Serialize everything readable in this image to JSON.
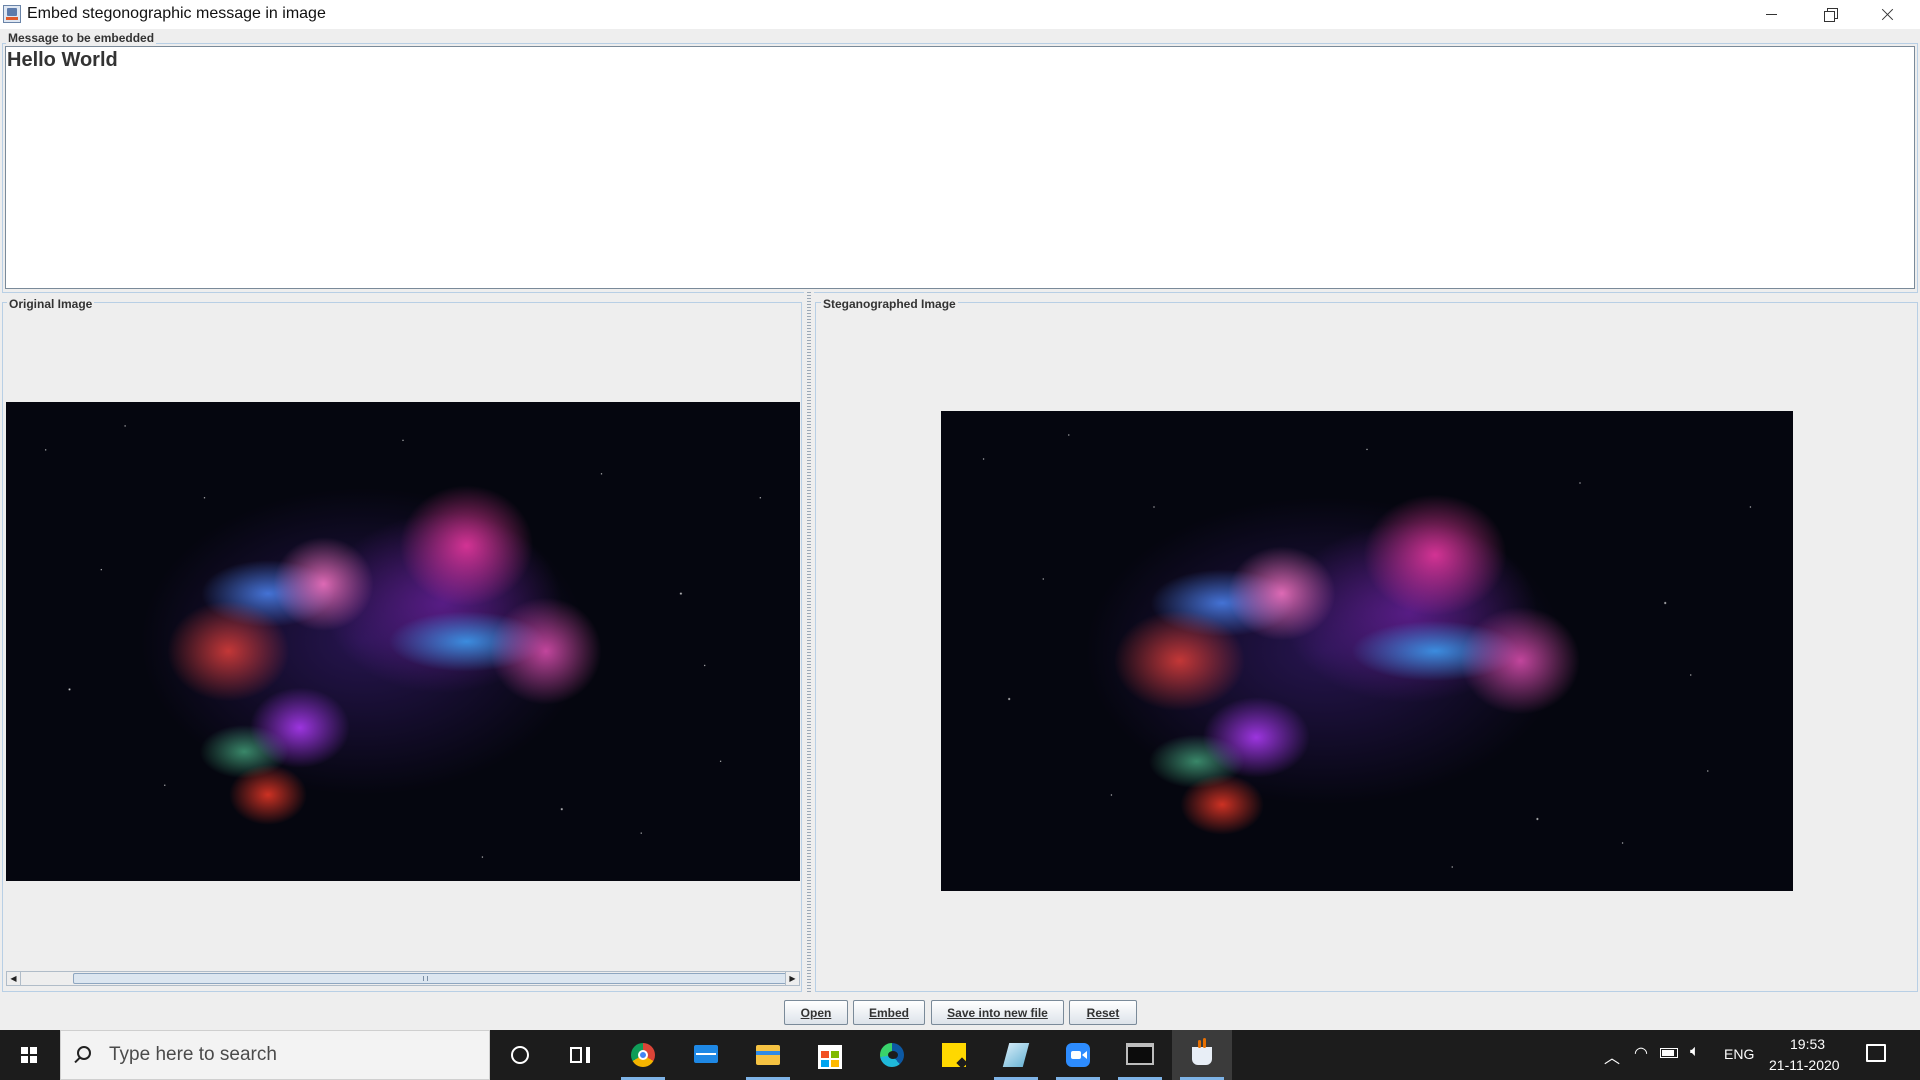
{
  "window": {
    "title": "Embed stegonographic message in image"
  },
  "message_panel": {
    "label": "Message to be embedded",
    "text": "Hello World"
  },
  "original_panel": {
    "label": "Original Image"
  },
  "stego_panel": {
    "label": "Steganographed Image"
  },
  "buttons": {
    "open": "Open",
    "embed": "Embed",
    "save": "Save into new file",
    "reset": "Reset"
  },
  "taskbar": {
    "search_placeholder": "Type here to search",
    "apps": [
      "cortana-icon",
      "task-view-icon",
      "chrome-icon",
      "mail-icon",
      "file-explorer-icon",
      "store-icon",
      "edge-icon",
      "sticky-notes-icon",
      "notepad-icon",
      "zoom-icon",
      "terminal-icon",
      "java-icon"
    ],
    "language": "ENG",
    "time": "19:53",
    "date": "21-11-2020"
  },
  "colors": {
    "panel_bg": "#eeeeee",
    "border": "#b8cfe5",
    "taskbar_bg": "#1c1c1c",
    "accent": "#7eb3e6"
  }
}
